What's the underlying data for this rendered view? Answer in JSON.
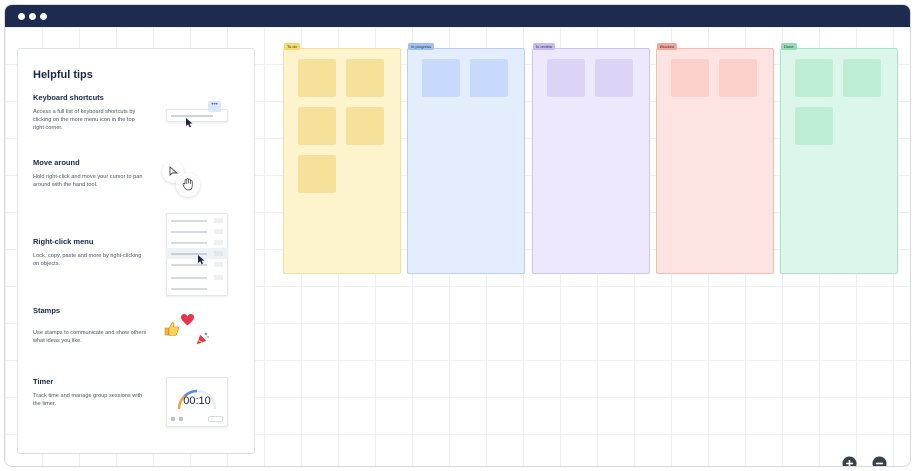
{
  "panel": {
    "title": "Helpful tips",
    "tips": [
      {
        "title": "Keyboard shortcuts",
        "desc": "Access a full list of keyboard shortcuts by clicking on the more menu icon in the top right corner."
      },
      {
        "title": "Move around",
        "desc": "Hold right-click and move your cursor to pan around with the hand tool."
      },
      {
        "title": "Right-click menu",
        "desc": "Lock, copy, paste and more by right-clicking on objects."
      },
      {
        "title": "Stamps",
        "desc": "Use stamps to communicate and show others what ideas you like."
      },
      {
        "title": "Timer",
        "desc": "Track time and manage group sessions with the timer."
      }
    ],
    "timer_value": "00:10"
  },
  "board": {
    "columns": [
      {
        "label": "To do",
        "notes": 5,
        "bg": "#fdf3cc",
        "border": "#f2e19a",
        "note": "#f6e19a",
        "tag": "#f5d96b"
      },
      {
        "label": "In progress",
        "notes": 2,
        "bg": "#e3edfc",
        "border": "#b9cff3",
        "note": "#c8dafb",
        "tag": "#9ec0f4"
      },
      {
        "label": "In review",
        "notes": 2,
        "bg": "#ede8fb",
        "border": "#cfc5f0",
        "note": "#ddd3f7",
        "tag": "#c7b8f2"
      },
      {
        "label": "Blocked",
        "notes": 2,
        "bg": "#fde4e2",
        "border": "#f3bdb8",
        "note": "#fbcfca",
        "tag": "#f4a59c"
      },
      {
        "label": "Done",
        "notes": 3,
        "bg": "#dcf6ea",
        "border": "#a9e4c6",
        "note": "#bdeed5",
        "tag": "#92dcb6"
      }
    ]
  },
  "colors": {
    "titlebar": "#1d2c4e",
    "accent": "#1b2748"
  },
  "icons": [
    "zoom-in-icon",
    "zoom-out-icon",
    "more-icon",
    "cursor-icon",
    "hand-icon",
    "thumbs-up-icon",
    "heart-icon",
    "party-icon"
  ]
}
